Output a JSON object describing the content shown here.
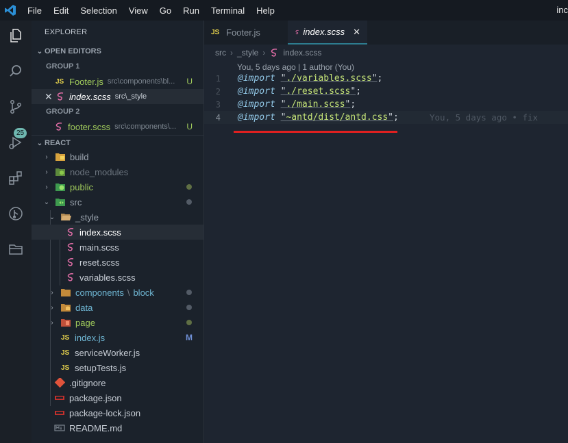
{
  "menu": [
    "File",
    "Edit",
    "Selection",
    "View",
    "Go",
    "Run",
    "Terminal",
    "Help"
  ],
  "title_right": "inc",
  "activity": {
    "items": [
      "explorer-icon",
      "search-icon",
      "source-control-icon",
      "run-debug-icon",
      "extensions-icon",
      "git-graph-icon",
      "folder-icon"
    ],
    "scm_badge": "25"
  },
  "sidebar": {
    "title": "EXPLORER",
    "open_editors": {
      "label": "OPEN EDITORS",
      "group1": "GROUP 1",
      "group1_items": [
        {
          "icon": "JS",
          "name": "Footer.js",
          "path": "src\\components\\bl...",
          "status": "U"
        },
        {
          "icon": "sass-icon",
          "name": "index.scss",
          "path": "src\\_style",
          "status": ""
        }
      ],
      "group2": "GROUP 2",
      "group2_items": [
        {
          "icon": "sass-icon",
          "name": "footer.scss",
          "path": "src\\components\\...",
          "status": "U"
        }
      ]
    },
    "workspace": {
      "label": "REACT",
      "tree": [
        {
          "name": "build"
        },
        {
          "name": "node_modules"
        },
        {
          "name": "public"
        },
        {
          "name": "src"
        },
        {
          "name": "_style"
        },
        {
          "name": "index.scss"
        },
        {
          "name": "main.scss"
        },
        {
          "name": "reset.scss"
        },
        {
          "name": "variables.scss"
        },
        {
          "name": "components",
          "suffix": "block"
        },
        {
          "name": "data"
        },
        {
          "name": "page"
        },
        {
          "name": "index.js",
          "status": "M"
        },
        {
          "name": "serviceWorker.js"
        },
        {
          "name": "setupTests.js"
        },
        {
          "name": ".gitignore"
        },
        {
          "name": "package.json"
        },
        {
          "name": "package-lock.json"
        },
        {
          "name": "README.md"
        }
      ]
    }
  },
  "editor": {
    "tabs": [
      {
        "icon": "JS",
        "label": "Footer.js"
      },
      {
        "icon": "sass-icon",
        "label": "index.scss"
      }
    ],
    "breadcrumb": [
      "src",
      "_style",
      "index.scss"
    ],
    "codelens": "You, 5 days ago | 1 author (You)",
    "lines": [
      {
        "num": "1",
        "kw": "@import",
        "path": "./variables.scss"
      },
      {
        "num": "2",
        "kw": "@import",
        "path": "./reset.scss"
      },
      {
        "num": "3",
        "kw": "@import",
        "path": "./main.scss"
      },
      {
        "num": "4",
        "kw": "@import",
        "path": "~antd/dist/antd.css"
      }
    ],
    "inline_blame": "You, 5 days ago • fix"
  },
  "colors": {
    "accent": "#2d7c8f",
    "modified": "#9fc95b",
    "js_yellow": "#e8d44d",
    "sass_pink": "#e36ea8",
    "annotation_red": "#e02020"
  }
}
